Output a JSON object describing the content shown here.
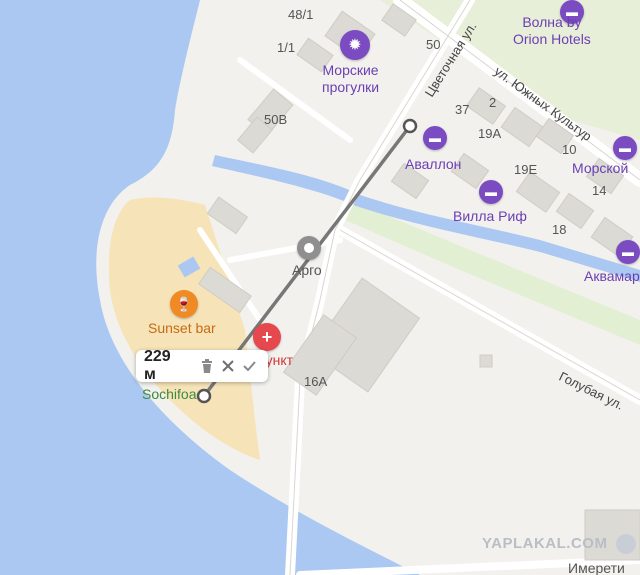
{
  "map": {
    "colors": {
      "sea": "#aac8f2",
      "beach": "#f6e4b8",
      "land": "#f2f1ed",
      "park": "#e3efd3",
      "building": "#dcdad4",
      "road": "#ffffff",
      "channel": "#aac8f2",
      "ruler": "#777777"
    },
    "house_numbers": [
      "48/1",
      "1/1",
      "50",
      "50В",
      "37",
      "2",
      "19А",
      "10",
      "19Е",
      "14",
      "18",
      "16А"
    ],
    "streets": [
      "Цветочная ул.",
      "ул. Южных Культур",
      "Голубая ул."
    ],
    "pois": [
      {
        "label": "Морские\nпрогулки",
        "icon": "boat-icon"
      },
      {
        "label": "Волна by\nOrion Hotels",
        "icon": "bed-icon"
      },
      {
        "label": "Аваллон",
        "icon": "bed-icon"
      },
      {
        "label": "Вилла Риф",
        "icon": "bed-icon"
      },
      {
        "label": "Морской",
        "icon": "bed-icon"
      },
      {
        "label": "Аквамар",
        "icon": "bed-icon"
      },
      {
        "label": "Арго",
        "icon": "pin-icon"
      },
      {
        "label": "Sunset bar",
        "icon": "cocktail-icon"
      },
      {
        "label": "пункт",
        "icon": "medical-cross-icon"
      },
      {
        "label": "Sochifoa",
        "icon": ""
      },
      {
        "label": "Имерети",
        "icon": ""
      }
    ]
  },
  "ruler": {
    "distance": "229 м",
    "delete_icon": "trash-icon",
    "close_icon": "close-icon",
    "confirm_icon": "check-icon"
  },
  "watermark": "YAPLAKAL.COM"
}
